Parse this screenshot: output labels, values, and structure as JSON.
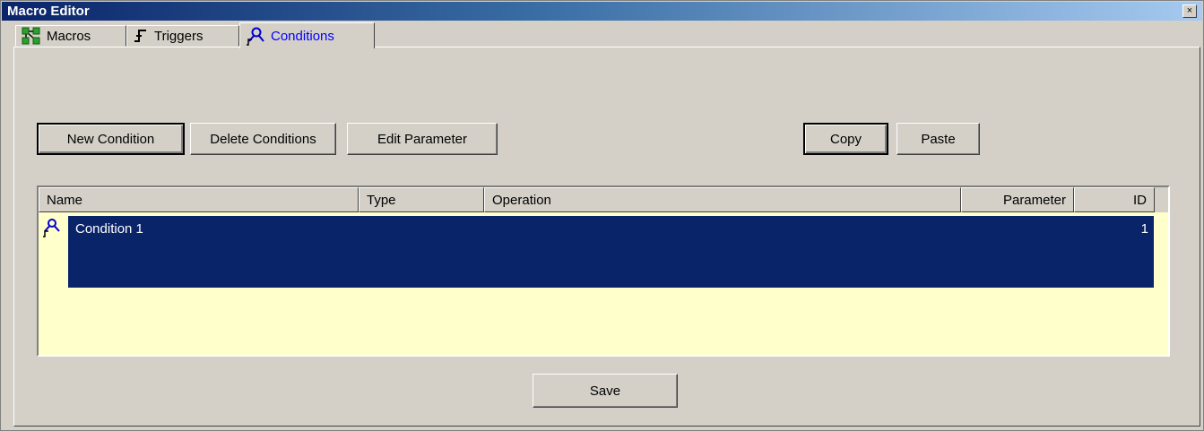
{
  "window": {
    "title": "Macro Editor",
    "close_glyph": "×"
  },
  "tabs": [
    {
      "label": "Macros",
      "icon": "macros-icon",
      "active": false
    },
    {
      "label": "Triggers",
      "icon": "triggers-icon",
      "active": false
    },
    {
      "label": "Conditions",
      "icon": "conditions-icon",
      "active": true
    }
  ],
  "toolbar": {
    "new_condition": "New Condition",
    "delete_conditions": "Delete Conditions",
    "edit_parameter": "Edit Parameter",
    "copy": "Copy",
    "paste": "Paste"
  },
  "table": {
    "columns": [
      "Name",
      "Type",
      "Operation",
      "Parameter",
      "ID"
    ],
    "rows": [
      {
        "name": "Condition 1",
        "type": "",
        "operation": "",
        "parameter": "",
        "id": "1",
        "selected": true,
        "icon": "condition-icon"
      }
    ]
  },
  "footer": {
    "save": "Save"
  },
  "colors": {
    "selection": "#0a246a",
    "list_background": "#ffffcc",
    "active_tab_text": "#0000ff"
  }
}
